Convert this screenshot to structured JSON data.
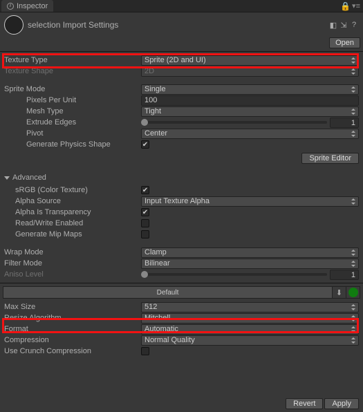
{
  "tab": {
    "title": "Inspector"
  },
  "header": {
    "title": "selection Import Settings",
    "open": "Open"
  },
  "rows": {
    "textureType": {
      "label": "Texture Type",
      "value": "Sprite (2D and UI)"
    },
    "textureShape": {
      "label": "Texture Shape",
      "value": "2D"
    },
    "spriteMode": {
      "label": "Sprite Mode",
      "value": "Single"
    },
    "pixelsPerUnit": {
      "label": "Pixels Per Unit",
      "value": "100"
    },
    "meshType": {
      "label": "Mesh Type",
      "value": "Tight"
    },
    "extrudeEdges": {
      "label": "Extrude Edges",
      "value": "1"
    },
    "pivot": {
      "label": "Pivot",
      "value": "Center"
    },
    "genPhysics": {
      "label": "Generate Physics Shape",
      "checked": true
    },
    "spriteEditor": "Sprite Editor",
    "advanced": "Advanced",
    "srgb": {
      "label": "sRGB (Color Texture)",
      "checked": true
    },
    "alphaSource": {
      "label": "Alpha Source",
      "value": "Input Texture Alpha"
    },
    "alphaTrans": {
      "label": "Alpha Is Transparency",
      "checked": true
    },
    "readWrite": {
      "label": "Read/Write Enabled",
      "checked": false
    },
    "genMips": {
      "label": "Generate Mip Maps",
      "checked": false
    },
    "wrapMode": {
      "label": "Wrap Mode",
      "value": "Clamp"
    },
    "filterMode": {
      "label": "Filter Mode",
      "value": "Bilinear"
    },
    "anisoLevel": {
      "label": "Aniso Level",
      "value": "1"
    },
    "platformDefault": "Default",
    "maxSize": {
      "label": "Max Size",
      "value": "512"
    },
    "resizeAlg": {
      "label": "Resize Algorithm",
      "value": "Mitchell"
    },
    "format": {
      "label": "Format",
      "value": "Automatic"
    },
    "compression": {
      "label": "Compression",
      "value": "Normal Quality"
    },
    "crunch": {
      "label": "Use Crunch Compression",
      "checked": false
    }
  },
  "footer": {
    "revert": "Revert",
    "apply": "Apply"
  }
}
